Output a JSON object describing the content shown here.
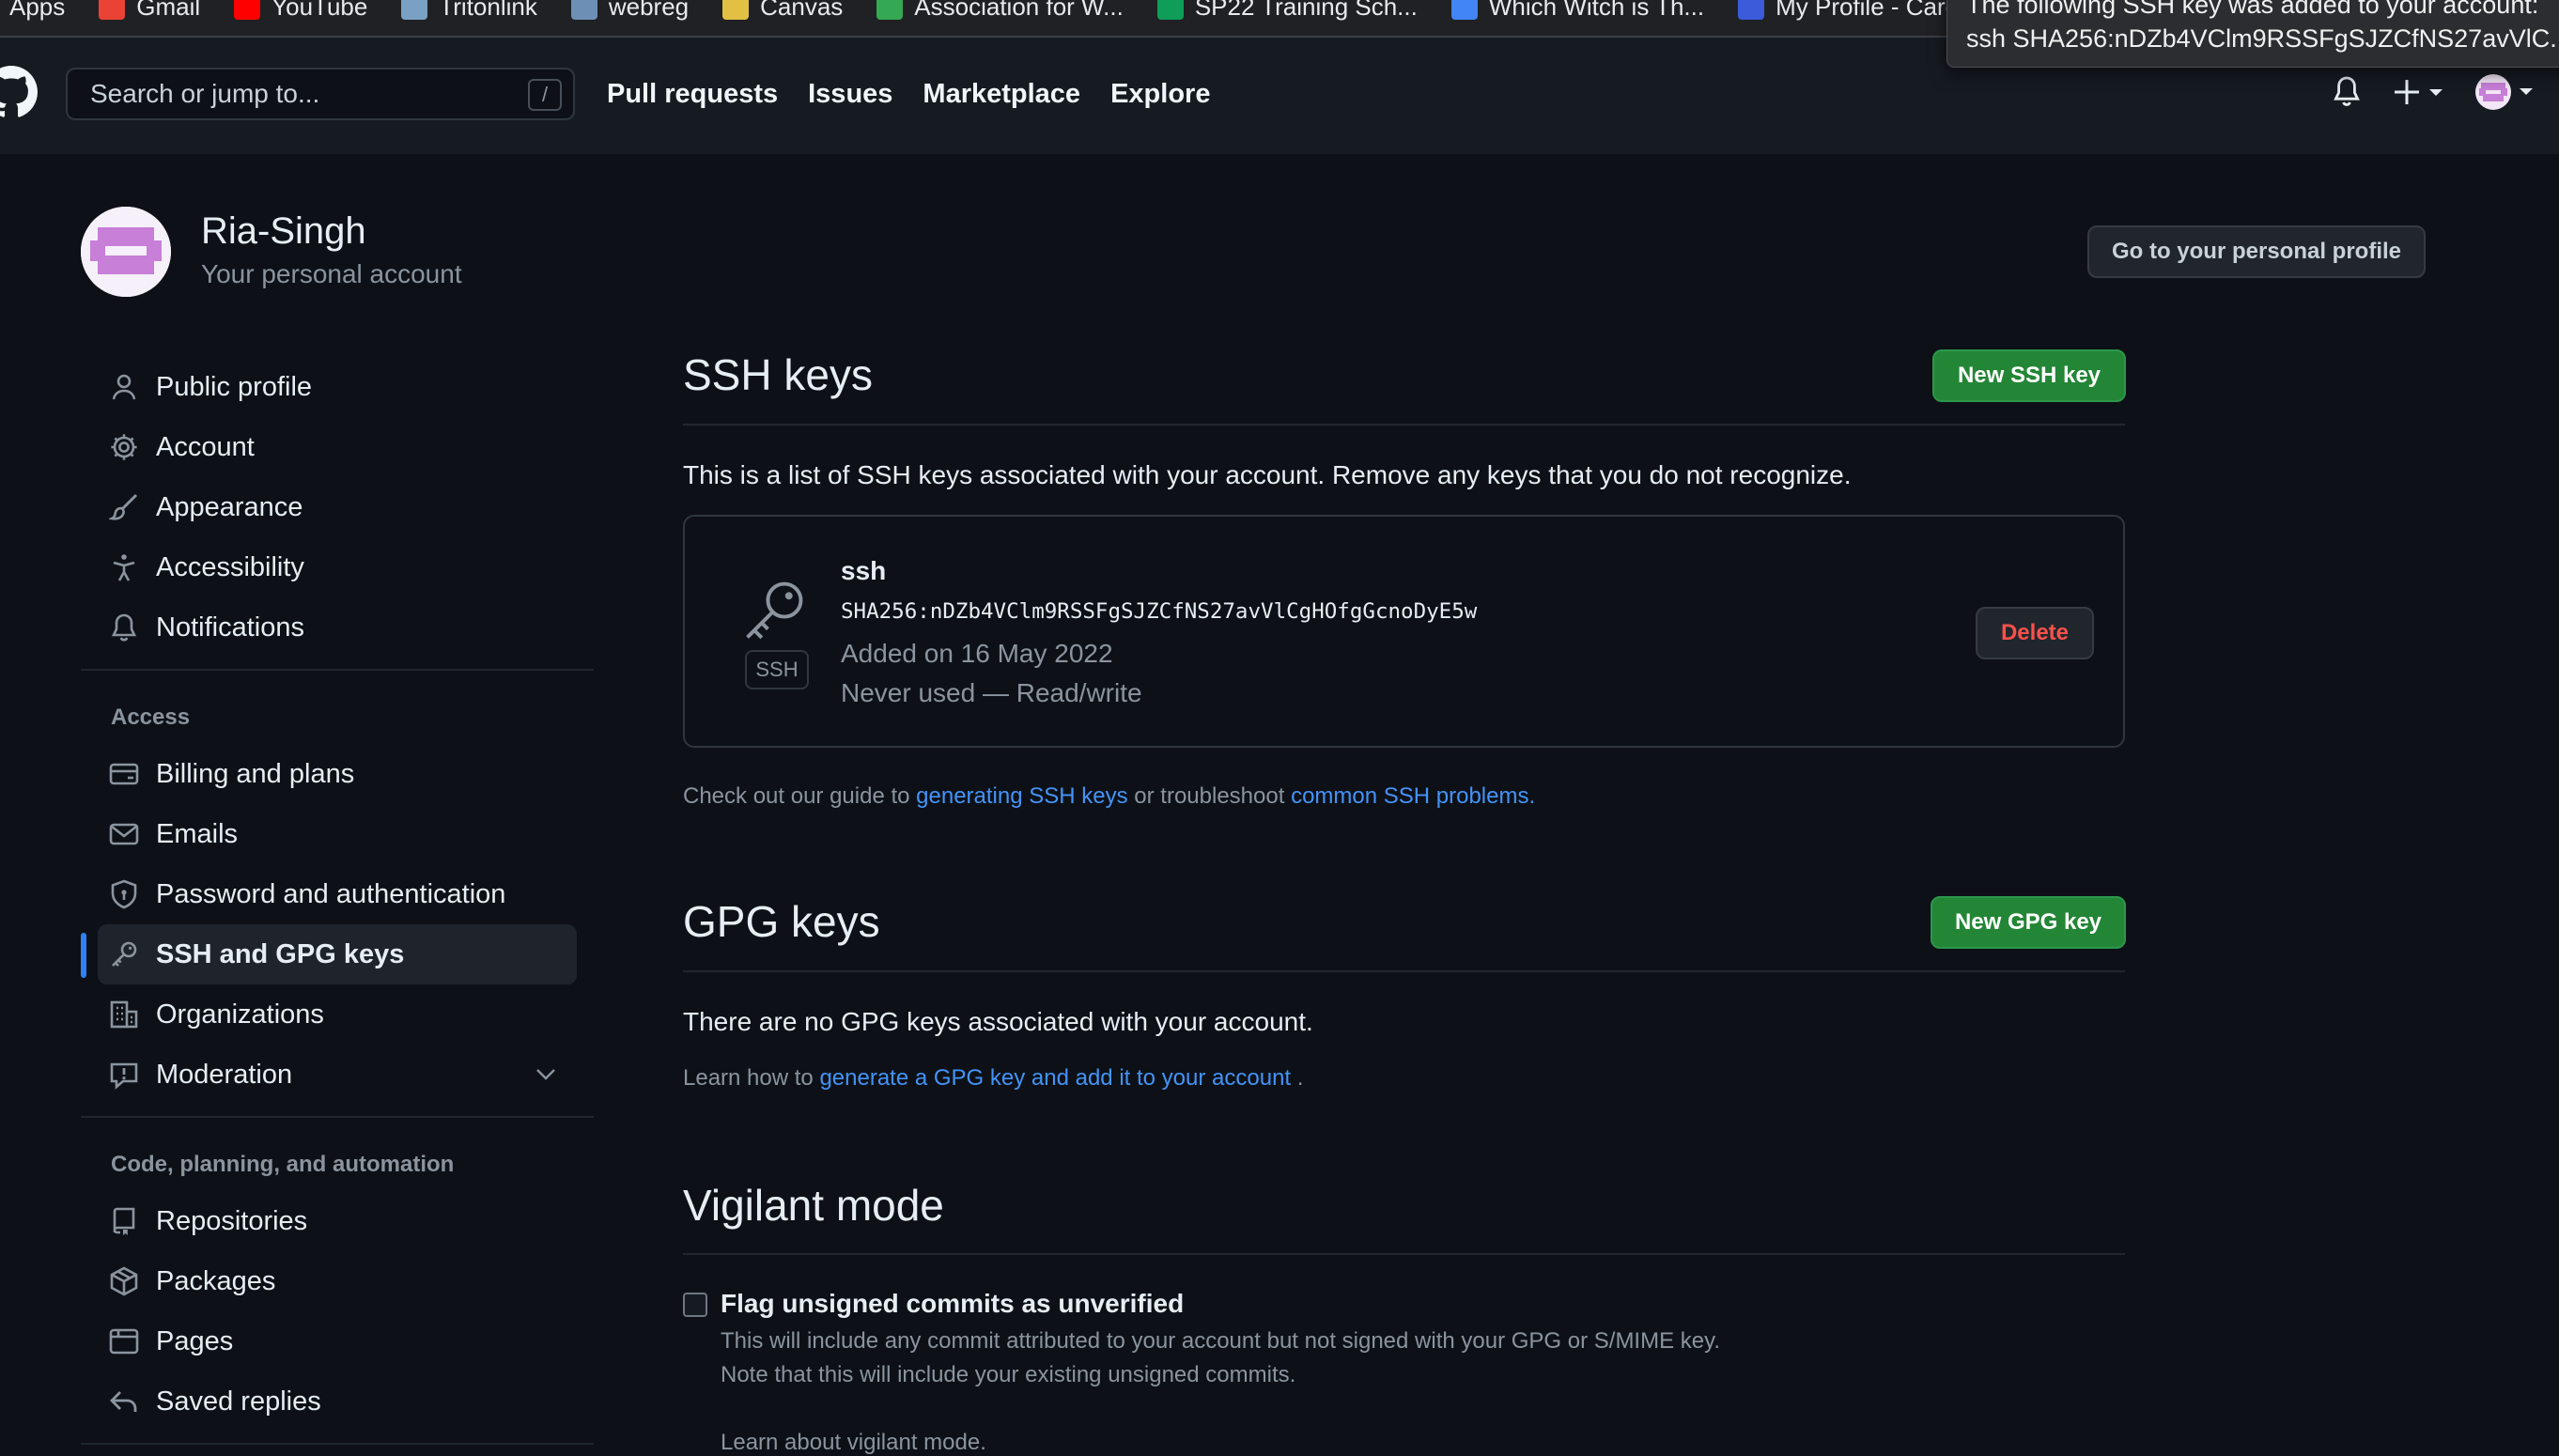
{
  "bookmarks": [
    {
      "label": "Apps",
      "icon": "apps-grid-icon",
      "color": "#8ab4f8"
    },
    {
      "label": "Gmail",
      "icon": "gmail-icon",
      "color": "#ea4335"
    },
    {
      "label": "YouTube",
      "icon": "youtube-icon",
      "color": "#ff0000"
    },
    {
      "label": "Tritonlink",
      "icon": "tritonlink-icon",
      "color": "#7aa0c4"
    },
    {
      "label": "webreg",
      "icon": "webreg-icon",
      "color": "#6e8fb5"
    },
    {
      "label": "Canvas",
      "icon": "canvas-icon",
      "color": "#e2c044"
    },
    {
      "label": "Association for W...",
      "icon": "drive-icon",
      "color": "#34a853"
    },
    {
      "label": "SP22 Training Sch...",
      "icon": "sheets-icon",
      "color": "#0f9d58"
    },
    {
      "label": "Which Witch is Th...",
      "icon": "quiz-icon",
      "color": "#4285f4"
    },
    {
      "label": "My Profile - Caree",
      "icon": "career-icon",
      "color": "#3b5bdb"
    }
  ],
  "tooltip": {
    "line1": "The following SSH key was added to your account:",
    "line2": "ssh SHA256:nDZb4VClm9RSSFgSJZCfNS27avVlC..."
  },
  "header": {
    "search_placeholder": "Search or jump to...",
    "search_shortcut": "/",
    "nav": [
      "Pull requests",
      "Issues",
      "Marketplace",
      "Explore"
    ]
  },
  "account": {
    "name": "Ria-Singh",
    "subtitle": "Your personal account",
    "profile_button": "Go to your personal profile"
  },
  "sidebar": {
    "items": [
      {
        "label": "Public profile",
        "icon": "person-icon"
      },
      {
        "label": "Account",
        "icon": "gear-icon"
      },
      {
        "label": "Appearance",
        "icon": "paintbrush-icon"
      },
      {
        "label": "Accessibility",
        "icon": "accessibility-icon"
      },
      {
        "label": "Notifications",
        "icon": "bell-icon"
      }
    ],
    "access_heading": "Access",
    "access_items": [
      {
        "label": "Billing and plans",
        "icon": "credit-card-icon"
      },
      {
        "label": "Emails",
        "icon": "mail-icon"
      },
      {
        "label": "Password and authentication",
        "icon": "shield-lock-icon"
      },
      {
        "label": "SSH and GPG keys",
        "icon": "key-icon",
        "active": true
      },
      {
        "label": "Organizations",
        "icon": "organization-icon"
      },
      {
        "label": "Moderation",
        "icon": "report-icon"
      }
    ],
    "code_heading": "Code, planning, and automation",
    "code_items": [
      {
        "label": "Repositories",
        "icon": "repo-icon"
      },
      {
        "label": "Packages",
        "icon": "package-icon"
      },
      {
        "label": "Pages",
        "icon": "browser-icon"
      },
      {
        "label": "Saved replies",
        "icon": "reply-icon"
      }
    ]
  },
  "ssh": {
    "title": "SSH keys",
    "new_button": "New SSH key",
    "description": "This is a list of SSH keys associated with your account. Remove any keys that you do not recognize.",
    "key": {
      "badge": "SSH",
      "title": "ssh",
      "fingerprint": "SHA256:nDZb4VClm9RSSFgSJZCfNS27avVlCgHOfgGcnoDyE5w",
      "added": "Added on 16 May 2022",
      "usage": "Never used — Read/write",
      "delete_button": "Delete"
    },
    "guide_prefix": "Check out our guide to ",
    "guide_link1": "generating SSH keys",
    "guide_mid": " or troubleshoot ",
    "guide_link2": "common SSH problems",
    "guide_suffix": "."
  },
  "gpg": {
    "title": "GPG keys",
    "new_button": "New GPG key",
    "empty": "There are no GPG keys associated with your account.",
    "learn_prefix": "Learn how to ",
    "learn_link": "generate a GPG key and add it to your account",
    "learn_suffix": " ."
  },
  "vigilant": {
    "title": "Vigilant mode",
    "checkbox_label": "Flag unsigned commits as unverified",
    "checked": false,
    "note1": "This will include any commit attributed to your account but not signed with your GPG or S/MIME key.",
    "note2": "Note that this will include your existing unsigned commits.",
    "learn_link": "Learn about vigilant mode."
  },
  "colors": {
    "background": "#0d1117",
    "header": "#161b22",
    "accent_blue": "#2f81f7",
    "link": "#4493f8",
    "button_green": "#238636",
    "danger": "#f85149"
  }
}
